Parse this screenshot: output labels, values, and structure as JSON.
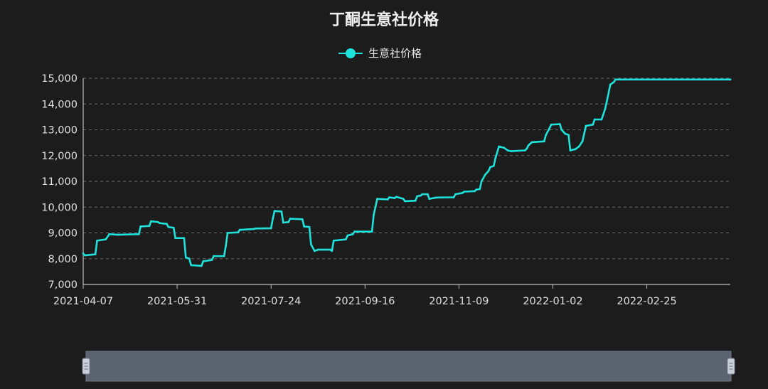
{
  "chart_data": {
    "type": "line",
    "title": "丁酮生意社价格",
    "legend": {
      "placement": "top-center",
      "entries": [
        "生意社价格"
      ]
    },
    "xlabel": "",
    "ylabel": "",
    "ylim": [
      7000,
      15000
    ],
    "yticks": [
      7000,
      8000,
      9000,
      10000,
      11000,
      12000,
      13000,
      14000,
      15000
    ],
    "ytick_labels": [
      "7,000",
      "8,000",
      "9,000",
      "10,000",
      "11,000",
      "12,000",
      "13,000",
      "14,000",
      "15,000"
    ],
    "xlim": [
      "2021-04-07",
      "2022-04-14"
    ],
    "xtick_labels": [
      "2021-04-07",
      "2021-05-31",
      "2021-07-24",
      "2021-09-16",
      "2021-11-09",
      "2022-01-02",
      "2022-02-25"
    ],
    "grid": {
      "y": true,
      "x": false
    },
    "series": [
      {
        "name": "生意社价格",
        "color": "#1ee3dc",
        "points": [
          [
            "2021-04-07",
            8200
          ],
          [
            "2021-04-08",
            8130
          ],
          [
            "2021-04-14",
            8170
          ],
          [
            "2021-04-15",
            8700
          ],
          [
            "2021-04-20",
            8750
          ],
          [
            "2021-04-22",
            8950
          ],
          [
            "2021-04-27",
            8930
          ],
          [
            "2021-05-09",
            8950
          ],
          [
            "2021-05-10",
            9250
          ],
          [
            "2021-05-15",
            9270
          ],
          [
            "2021-05-16",
            9450
          ],
          [
            "2021-05-20",
            9420
          ],
          [
            "2021-05-21",
            9380
          ],
          [
            "2021-05-25",
            9350
          ],
          [
            "2021-05-26",
            9230
          ],
          [
            "2021-05-29",
            9200
          ],
          [
            "2021-05-30",
            8800
          ],
          [
            "2021-06-01",
            8800
          ],
          [
            "2021-06-04",
            8800
          ],
          [
            "2021-06-05",
            8050
          ],
          [
            "2021-06-07",
            8000
          ],
          [
            "2021-06-08",
            7750
          ],
          [
            "2021-06-14",
            7720
          ],
          [
            "2021-06-15",
            7900
          ],
          [
            "2021-06-20",
            7950
          ],
          [
            "2021-06-21",
            8100
          ],
          [
            "2021-06-27",
            8100
          ],
          [
            "2021-06-28",
            8500
          ],
          [
            "2021-06-29",
            9000
          ],
          [
            "2021-07-05",
            9020
          ],
          [
            "2021-07-06",
            9120
          ],
          [
            "2021-07-14",
            9150
          ],
          [
            "2021-07-15",
            9170
          ],
          [
            "2021-07-24",
            9180
          ],
          [
            "2021-07-25",
            9550
          ],
          [
            "2021-07-26",
            9850
          ],
          [
            "2021-07-30",
            9830
          ],
          [
            "2021-07-31",
            9400
          ],
          [
            "2021-08-03",
            9420
          ],
          [
            "2021-08-04",
            9550
          ],
          [
            "2021-08-11",
            9530
          ],
          [
            "2021-08-12",
            9250
          ],
          [
            "2021-08-15",
            9230
          ],
          [
            "2021-08-16",
            8550
          ],
          [
            "2021-08-18",
            8300
          ],
          [
            "2021-08-20",
            8350
          ],
          [
            "2021-08-27",
            8350
          ],
          [
            "2021-08-28",
            8300
          ],
          [
            "2021-08-29",
            8700
          ],
          [
            "2021-09-05",
            8750
          ],
          [
            "2021-09-06",
            8900
          ],
          [
            "2021-09-09",
            8950
          ],
          [
            "2021-09-10",
            9050
          ],
          [
            "2021-09-20",
            9050
          ],
          [
            "2021-09-21",
            9700
          ],
          [
            "2021-09-22",
            10000
          ],
          [
            "2021-09-23",
            10320
          ],
          [
            "2021-09-29",
            10300
          ],
          [
            "2021-09-30",
            10380
          ],
          [
            "2021-10-03",
            10350
          ],
          [
            "2021-10-04",
            10400
          ],
          [
            "2021-10-08",
            10320
          ],
          [
            "2021-10-09",
            10230
          ],
          [
            "2021-10-15",
            10250
          ],
          [
            "2021-10-16",
            10420
          ],
          [
            "2021-10-18",
            10450
          ],
          [
            "2021-10-19",
            10500
          ],
          [
            "2021-10-22",
            10500
          ],
          [
            "2021-10-23",
            10320
          ],
          [
            "2021-10-27",
            10370
          ],
          [
            "2021-11-06",
            10380
          ],
          [
            "2021-11-07",
            10500
          ],
          [
            "2021-11-11",
            10550
          ],
          [
            "2021-11-12",
            10600
          ],
          [
            "2021-11-18",
            10620
          ],
          [
            "2021-11-19",
            10680
          ],
          [
            "2021-11-21",
            10700
          ],
          [
            "2021-11-22",
            11000
          ],
          [
            "2021-11-24",
            11250
          ],
          [
            "2021-11-26",
            11400
          ],
          [
            "2021-11-27",
            11550
          ],
          [
            "2021-11-29",
            11600
          ],
          [
            "2021-11-30",
            11900
          ],
          [
            "2021-12-02",
            12350
          ],
          [
            "2021-12-05",
            12300
          ],
          [
            "2021-12-07",
            12200
          ],
          [
            "2021-12-09",
            12170
          ],
          [
            "2021-12-17",
            12200
          ],
          [
            "2021-12-18",
            12270
          ],
          [
            "2021-12-19",
            12400
          ],
          [
            "2021-12-21",
            12520
          ],
          [
            "2021-12-28",
            12550
          ],
          [
            "2021-12-29",
            12800
          ],
          [
            "2021-12-31",
            13050
          ],
          [
            "2022-01-01",
            13200
          ],
          [
            "2022-01-06",
            13220
          ],
          [
            "2022-01-07",
            13000
          ],
          [
            "2022-01-09",
            12850
          ],
          [
            "2022-01-11",
            12800
          ],
          [
            "2022-01-12",
            12200
          ],
          [
            "2022-01-15",
            12250
          ],
          [
            "2022-01-17",
            12350
          ],
          [
            "2022-01-19",
            12550
          ],
          [
            "2022-01-21",
            13150
          ],
          [
            "2022-01-25",
            13200
          ],
          [
            "2022-01-26",
            13400
          ],
          [
            "2022-01-30",
            13400
          ],
          [
            "2022-02-01",
            13800
          ],
          [
            "2022-02-02",
            14100
          ],
          [
            "2022-02-04",
            14750
          ],
          [
            "2022-02-06",
            14850
          ],
          [
            "2022-02-07",
            14950
          ],
          [
            "2022-02-10",
            14950
          ],
          [
            "2022-04-14",
            14950
          ]
        ]
      }
    ],
    "data_zoom": {
      "start_percent": 0,
      "end_percent": 100
    }
  }
}
